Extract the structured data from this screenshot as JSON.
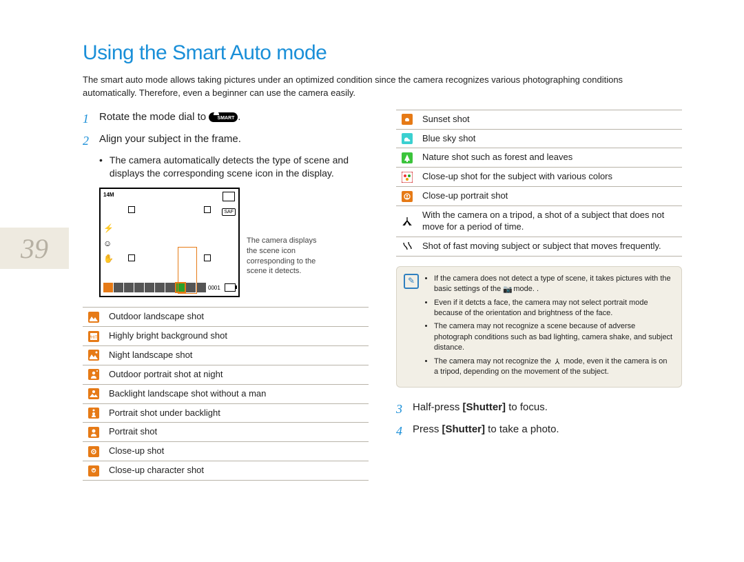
{
  "page_number": "39",
  "title": "Using the Smart Auto mode",
  "intro": "The smart auto mode allows taking pictures under an optimized condition since the camera recognizes various photographing conditions automatically. Therefore, even a beginner can use the camera easily.",
  "steps": {
    "s1_pre": "Rotate the mode dial to ",
    "s1_post": ".",
    "s2": "Align your subject in the frame.",
    "s2_bullet": "The camera automatically detects the type of scene and displays the corresponding scene icon in the display.",
    "s3_pre": "Half-press ",
    "s3_shutter": "[Shutter]",
    "s3_post": " to focus.",
    "s4_pre": "Press ",
    "s4_shutter": "[Shutter]",
    "s4_post": " to take a photo."
  },
  "lcd": {
    "resolution": "14M",
    "saf": "SAF",
    "counter": "0001"
  },
  "fig_caption": "The camera displays the scene icon corresponding to the scene it detects.",
  "scenes_left": [
    {
      "icon": "landscape",
      "color": "#e67a16",
      "label": "Outdoor landscape shot"
    },
    {
      "icon": "white",
      "color": "#e67a16",
      "label": "Highly bright background shot"
    },
    {
      "icon": "night-land",
      "color": "#e67a16",
      "label": "Night landscape shot"
    },
    {
      "icon": "night-port",
      "color": "#e67a16",
      "label": "Outdoor portrait shot at night"
    },
    {
      "icon": "backlight-l",
      "color": "#e67a16",
      "label": "Backlight landscape shot without a man"
    },
    {
      "icon": "backlight-p",
      "color": "#e67a16",
      "label": "Portrait shot under backlight"
    },
    {
      "icon": "portrait",
      "color": "#e67a16",
      "label": "Portrait shot"
    },
    {
      "icon": "closeup",
      "color": "#e67a16",
      "label": "Close-up shot"
    },
    {
      "icon": "closeup-char",
      "color": "#e67a16",
      "label": "Close-up character shot"
    }
  ],
  "scenes_right": [
    {
      "icon": "sunset",
      "color": "#e67a16",
      "label": "Sunset shot"
    },
    {
      "icon": "bluesky",
      "color": "#3bd0d0",
      "label": "Blue sky shot"
    },
    {
      "icon": "nature",
      "color": "#3cc43c",
      "label": "Nature shot such as forest and leaves"
    },
    {
      "icon": "macro-color",
      "color": "multi",
      "label": "Close-up shot for the subject with various colors"
    },
    {
      "icon": "closeup-port",
      "color": "#e67a16",
      "label": "Close-up portrait shot"
    },
    {
      "icon": "tripod",
      "color": "bw",
      "label": "With the camera on a tripod, a shot of a subject that does not move for a period of time."
    },
    {
      "icon": "action",
      "color": "bw",
      "label": "Shot of fast moving subject or subject that moves frequently."
    }
  ],
  "notes": {
    "n1a": "If the camera does not detect a type of scene, it takes pictures with the basic settings of the ",
    "n1b": " mode. .",
    "n2": "Even if it detcts a face, the camera may not select portrait mode because of the orientation and brightness of the face.",
    "n3": "The camera may not recognize a scene because of adverse photograph conditions such as bad lighting, camera shake, and subject distance.",
    "n4a": "The camera may not recognize the ",
    "n4b": " mode, even it the camera is on a tripod, depending on the movement of the subject."
  }
}
